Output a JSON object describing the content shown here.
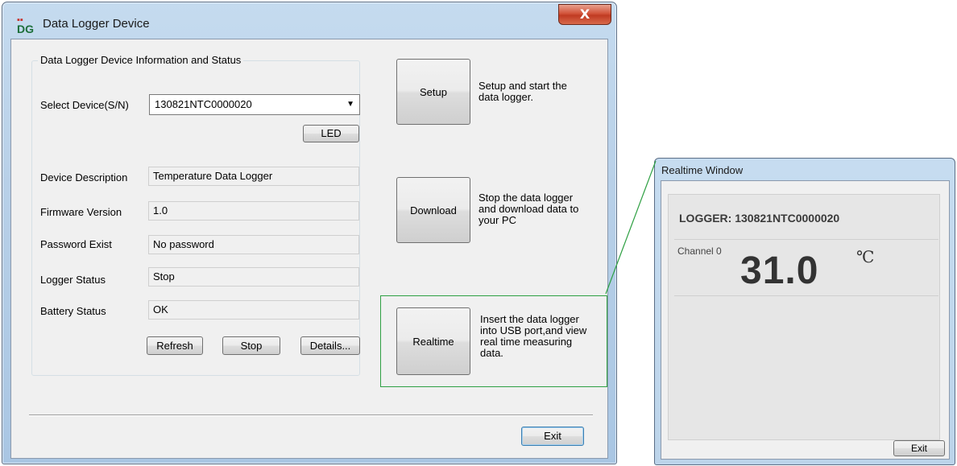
{
  "main_window": {
    "title": "Data Logger Device",
    "close_glyph": "X",
    "group_title": "Data Logger Device Information and Status",
    "select_device_label": "Select Device(S/N)",
    "select_device_value": "130821NTC0000020",
    "led_label": "LED",
    "fields": [
      {
        "label": "Device Description",
        "value": "Temperature Data Logger"
      },
      {
        "label": "Firmware Version",
        "value": "1.0"
      },
      {
        "label": "Password Exist",
        "value": "No password"
      },
      {
        "label": "Logger Status",
        "value": "Stop"
      },
      {
        "label": "Battery Status",
        "value": "OK"
      }
    ],
    "refresh_label": "Refresh",
    "stop_label": "Stop",
    "details_label": "Details...",
    "actions": [
      {
        "button": "Setup",
        "desc_lines": [
          "Setup and start the",
          "data logger."
        ]
      },
      {
        "button": "Download",
        "desc_lines": [
          "Stop the data logger",
          "and download data to",
          "your PC"
        ]
      },
      {
        "button": "Realtime",
        "desc_lines": [
          "Insert the data logger",
          "into USB port,and view",
          "real time measuring",
          "data."
        ]
      }
    ],
    "exit_label": "Exit"
  },
  "realtime_window": {
    "title": "Realtime Window",
    "logger_line": "LOGGER: 130821NTC0000020",
    "channel_label": "Channel 0",
    "value": "31.0",
    "unit": "℃",
    "exit_label": "Exit"
  },
  "colors": {
    "highlight": "#2ea043",
    "close_button": "#c8412a"
  },
  "icons": {
    "app": "dg-logo-icon",
    "dropdown": "chevron-down-icon"
  }
}
